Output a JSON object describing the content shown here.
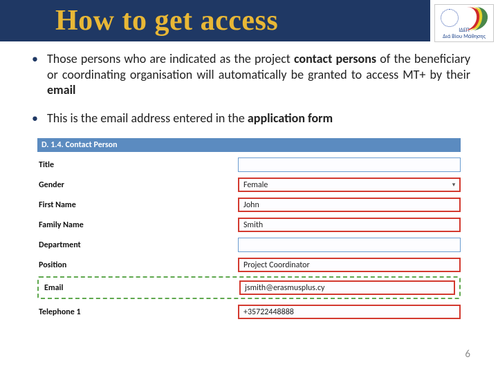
{
  "header": {
    "title": "How to get access",
    "logo_line1": "ΙΔΕΠ",
    "logo_line2": "Διά Βίου Μάθησης"
  },
  "bullets": {
    "b1_pre": "Those persons who are indicated as the project ",
    "b1_bold1": "contact persons",
    "b1_mid": " of the beneficiary or coordinating organisation will automatically be granted to access MT+ by their ",
    "b1_bold2": "email",
    "b2_pre": "This is the email address entered in the ",
    "b2_bold": "application form"
  },
  "form": {
    "section": "D. 1.4. Contact Person",
    "rows": {
      "title": {
        "label": "Title",
        "value": ""
      },
      "gender": {
        "label": "Gender",
        "value": "Female"
      },
      "first_name": {
        "label": "First Name",
        "value": "John"
      },
      "family_name": {
        "label": "Family Name",
        "value": "Smith"
      },
      "department": {
        "label": "Department",
        "value": ""
      },
      "position": {
        "label": "Position",
        "value": "Project Coordinator"
      },
      "email": {
        "label": "Email",
        "value": "jsmith@erasmusplus.cy"
      },
      "telephone1": {
        "label": "Telephone 1",
        "value": "+35722448888"
      }
    }
  },
  "page_number": "6"
}
